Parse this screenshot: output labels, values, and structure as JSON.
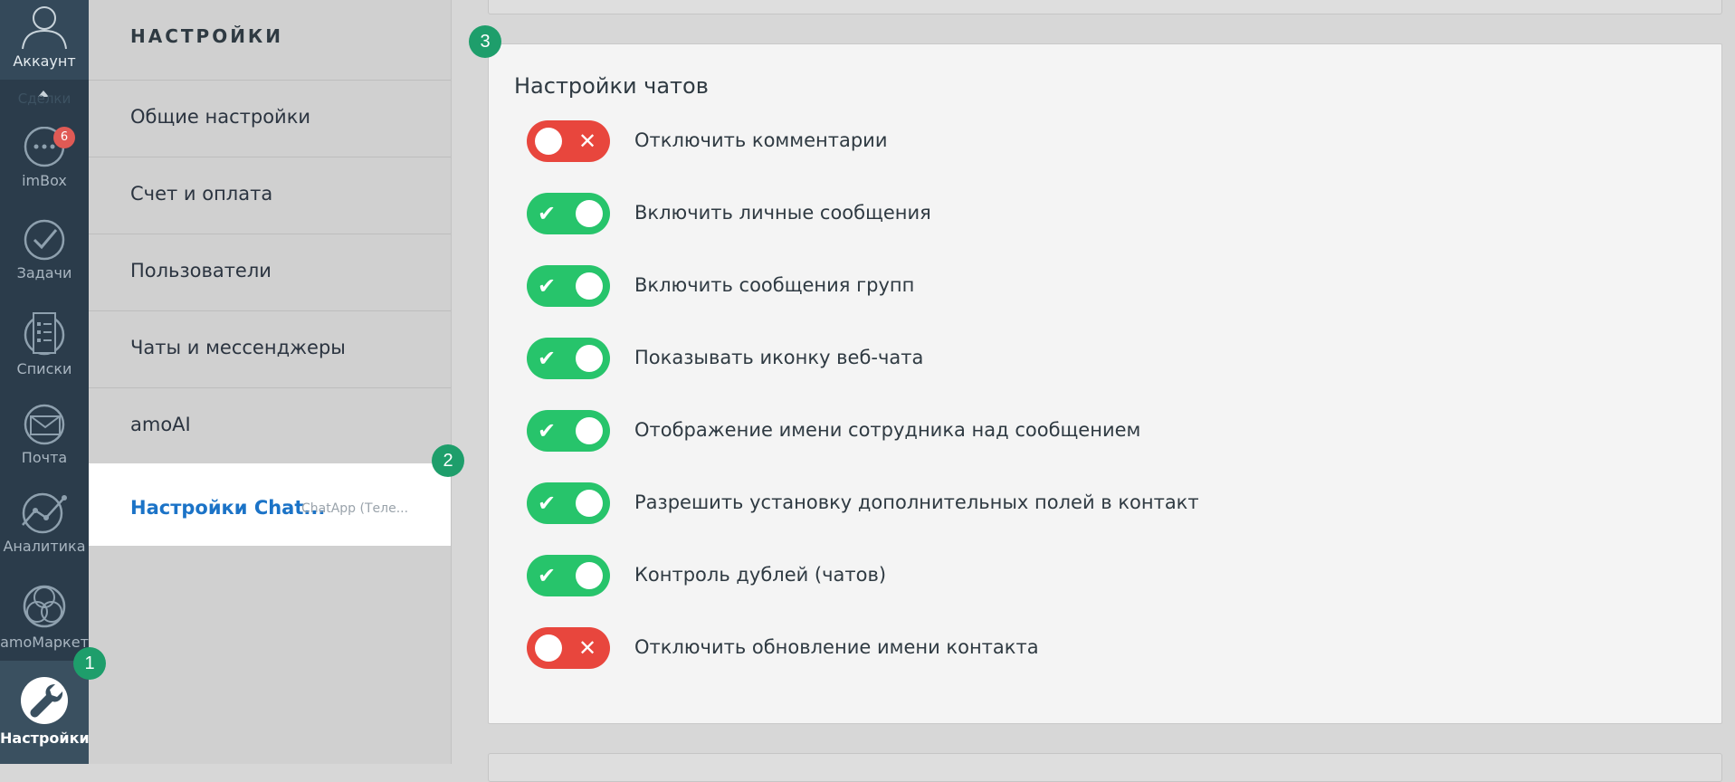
{
  "nav": {
    "account": "Аккаунт",
    "faded_item": "Сделки",
    "imbox": "imBox",
    "imbox_badge": "6",
    "tasks": "Задачи",
    "lists": "Списки",
    "mail": "Почта",
    "analytics": "Аналитика",
    "market": "amoМаркет",
    "settings": "Настройки"
  },
  "steps": [
    "1",
    "2",
    "3"
  ],
  "sidebar": {
    "title": "НАСТРОЙКИ",
    "items": [
      {
        "label": "Общие настройки"
      },
      {
        "label": "Счет и оплата"
      },
      {
        "label": "Пользователи"
      },
      {
        "label": "Чаты и мессенджеры"
      },
      {
        "label": "amoAI"
      },
      {
        "label": "Настройки Chat...",
        "sub": "ChatApp (Теле..."
      }
    ],
    "active_index": 5
  },
  "chat_settings": {
    "title": "Настройки чатов",
    "toggles": [
      {
        "label": "Отключить комментарии",
        "on": false
      },
      {
        "label": "Включить личные сообщения",
        "on": true
      },
      {
        "label": "Включить сообщения групп",
        "on": true
      },
      {
        "label": "Показывать иконку веб-чата",
        "on": true
      },
      {
        "label": "Отображение имени сотрудника над сообщением",
        "on": true
      },
      {
        "label": "Разрешить установку дополнительных полей в контакт",
        "on": true
      },
      {
        "label": "Контроль дублей (чатов)",
        "on": true
      },
      {
        "label": "Отключить обновление имени контакта",
        "on": false
      }
    ]
  },
  "colors": {
    "toggle_on": "#27c46b",
    "toggle_off": "#e8463d",
    "active_link": "#1b73c7",
    "step_badge": "#1e9e6b"
  }
}
